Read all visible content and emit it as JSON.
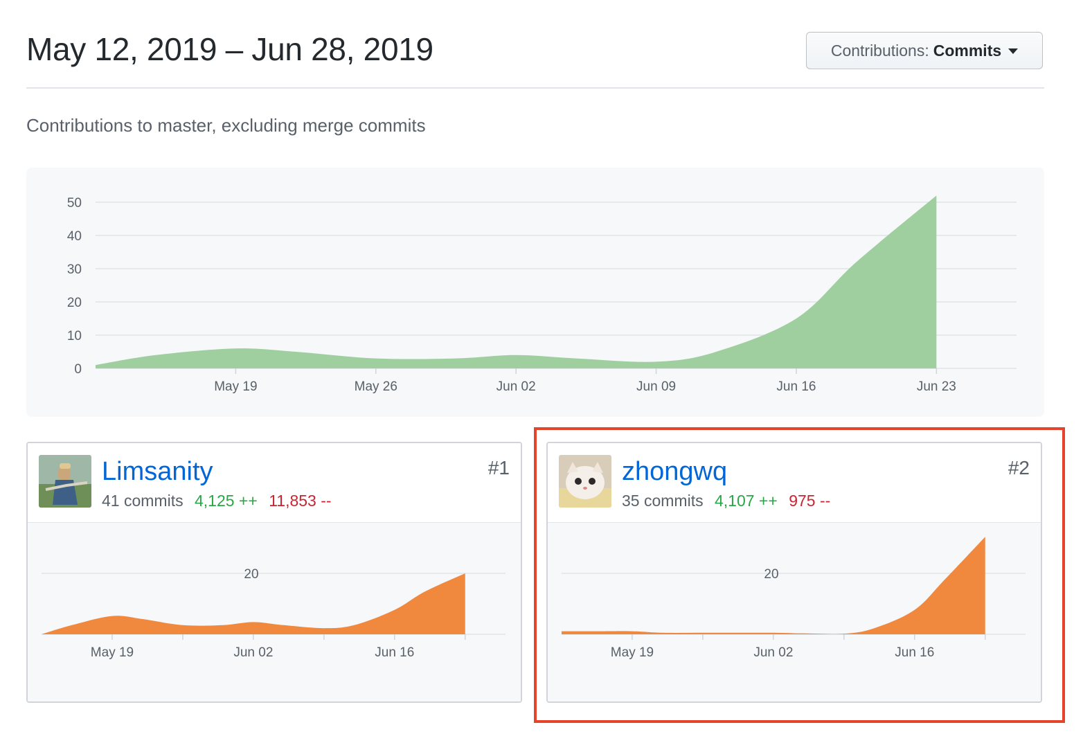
{
  "header": {
    "title": "May 12, 2019 – Jun 28, 2019",
    "contributions_label": "Contributions:",
    "contributions_value": "Commits"
  },
  "subtitle": "Contributions to master, excluding merge commits",
  "colors": {
    "main_area": "#9fcf9f",
    "user_area": "#f0883e",
    "link": "#0366d6",
    "additions": "#28a745",
    "deletions": "#cb2431",
    "highlight": "#e5432a"
  },
  "chart_data": [
    {
      "type": "area",
      "name": "overall-commits",
      "x": [
        "2019-05-12",
        "2019-05-15",
        "2019-05-19",
        "2019-05-22",
        "2019-05-26",
        "2019-05-30",
        "2019-06-02",
        "2019-06-05",
        "2019-06-09",
        "2019-06-12",
        "2019-06-16",
        "2019-06-19",
        "2019-06-23"
      ],
      "values": [
        1,
        4,
        6,
        5,
        3,
        3,
        4,
        3,
        2,
        5,
        15,
        32,
        52
      ],
      "xticks": [
        "May 19",
        "May 26",
        "Jun 02",
        "Jun 09",
        "Jun 16",
        "Jun 23"
      ],
      "yticks": [
        0,
        10,
        20,
        30,
        40,
        50
      ],
      "ylim": [
        0,
        55
      ],
      "xlim": [
        "2019-05-12",
        "2019-06-27"
      ],
      "grid": true
    },
    {
      "type": "area",
      "name": "user-1-commits",
      "x": [
        "2019-05-12",
        "2019-05-15",
        "2019-05-19",
        "2019-05-22",
        "2019-05-26",
        "2019-05-30",
        "2019-06-02",
        "2019-06-05",
        "2019-06-09",
        "2019-06-12",
        "2019-06-16",
        "2019-06-19",
        "2019-06-23"
      ],
      "values": [
        0,
        3,
        6,
        5,
        3,
        3,
        4,
        3,
        2,
        3,
        8,
        14,
        20
      ],
      "xticks": [
        "May 19",
        "Jun 02",
        "Jun 16"
      ],
      "ylabel_tick": "20",
      "ylim": [
        0,
        20
      ]
    },
    {
      "type": "area",
      "name": "user-2-commits",
      "x": [
        "2019-05-12",
        "2019-05-15",
        "2019-05-19",
        "2019-05-22",
        "2019-05-26",
        "2019-05-30",
        "2019-06-02",
        "2019-06-05",
        "2019-06-09",
        "2019-06-12",
        "2019-06-16",
        "2019-06-19",
        "2019-06-23"
      ],
      "values": [
        1,
        1,
        1,
        0.5,
        0.5,
        0.5,
        0.5,
        0.3,
        0.2,
        2,
        8,
        18,
        32
      ],
      "xticks": [
        "May 19",
        "Jun 02",
        "Jun 16"
      ],
      "ylabel_tick": "20",
      "ylim": [
        0,
        20
      ]
    }
  ],
  "contributors": [
    {
      "username": "Limsanity",
      "commits": "41 commits",
      "additions": "4,125 ++",
      "deletions": "11,853 --",
      "rank": "#1"
    },
    {
      "username": "zhongwq",
      "commits": "35 commits",
      "additions": "4,107 ++",
      "deletions": "975 --",
      "rank": "#2"
    }
  ]
}
